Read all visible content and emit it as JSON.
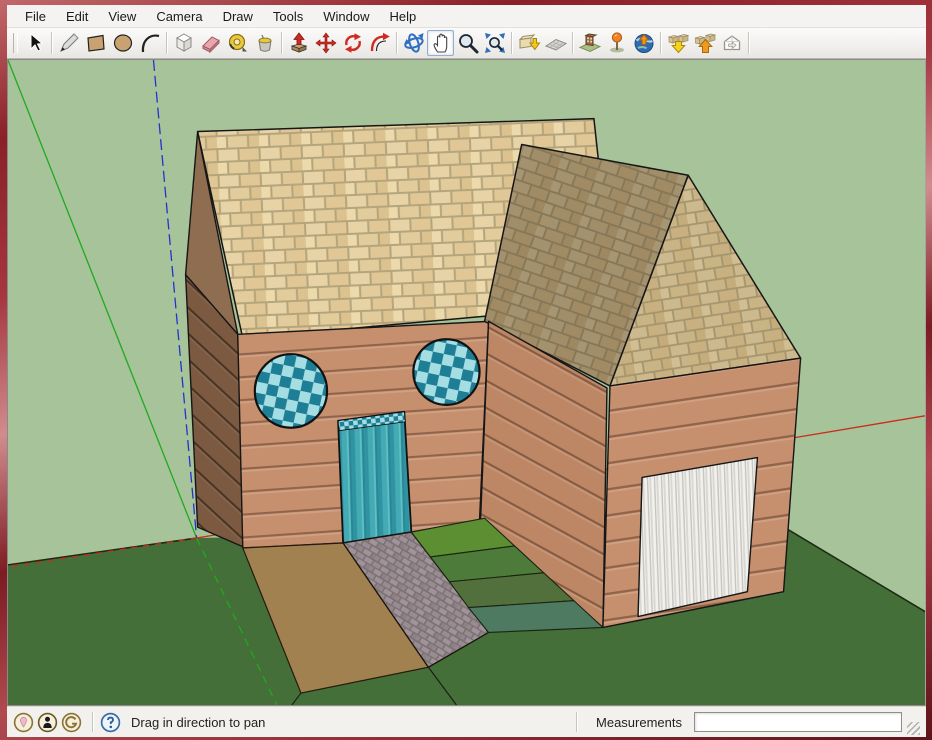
{
  "menu_bar": {
    "items": [
      "File",
      "Edit",
      "View",
      "Camera",
      "Draw",
      "Tools",
      "Window",
      "Help"
    ]
  },
  "toolbar": {
    "active_tool": "Pan",
    "tools": [
      "Select",
      "Line",
      "Rectangle",
      "Circle",
      "Arc",
      "Make Component",
      "Eraser",
      "Tape Measure",
      "Paint Bucket",
      "Push/Pull",
      "Move",
      "Rotate",
      "Offset",
      "Orbit",
      "Pan",
      "Zoom",
      "Zoom Extents",
      "Get Current View",
      "Toggle Terrain",
      "Photo Textures",
      "Add Location",
      "Preview Model in Google Earth",
      "Get Models",
      "Share Models",
      "Share Component"
    ]
  },
  "viewport": {
    "scene": {
      "type": "3d-house-model",
      "parts": [
        "gabled main wing with two round checkered windows and teal door",
        "gabled right wing with white ribbed garage door",
        "brick-textured roofs",
        "wood siding walls",
        "cobblestone path",
        "dirt patch",
        "four green turf tiles"
      ],
      "sky_color": "#a7c39a",
      "grass_color": "#456f38",
      "axis_colors": {
        "red": "#cc2b1a",
        "green": "#1faa1f",
        "blue": "#2433cc"
      }
    }
  },
  "status_bar": {
    "hint": "Drag in direction to pan",
    "measurements_label": "Measurements",
    "measurements_value": ""
  }
}
